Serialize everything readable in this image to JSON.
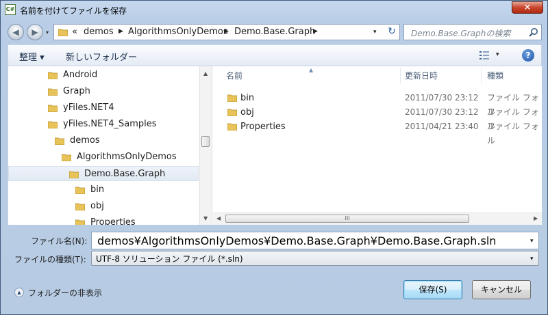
{
  "window": {
    "title": "名前を付けてファイルを保存",
    "app_icon_text": "C#",
    "close_glyph": "✕"
  },
  "nav": {
    "back_glyph": "◀",
    "forward_glyph": "▶",
    "breadcrumb": [
      "«",
      "demos",
      "AlgorithmsOnlyDemos",
      "Demo.Base.Graph"
    ],
    "separator_glyph": "▶",
    "dropdown_glyph": "▾",
    "refresh_glyph": "↻"
  },
  "search": {
    "placeholder": "Demo.Base.Graphの検索"
  },
  "toolbar": {
    "organize_label": "整理 ▾",
    "new_folder_label": "新しいフォルダー",
    "views_dropdown_glyph": "▾",
    "help_label": "?"
  },
  "tree": {
    "items": [
      {
        "label": "Android"
      },
      {
        "label": "Graph"
      },
      {
        "label": "yFiles.NET4"
      },
      {
        "label": "yFiles.NET4_Samples"
      },
      {
        "label": "demos"
      },
      {
        "label": "AlgorithmsOnlyDemos"
      },
      {
        "label": "Demo.Base.Graph",
        "selected": true
      },
      {
        "label": "bin"
      },
      {
        "label": "obj"
      },
      {
        "label": "Properties"
      }
    ],
    "scroll_up": "▲",
    "scroll_down": "▼"
  },
  "files": {
    "columns": {
      "name": "名前",
      "date": "更新日時",
      "type": "種類",
      "sort_glyph": "▲"
    },
    "rows": [
      {
        "name": "bin",
        "date": "2011/07/30 23:12",
        "type": "ファイル フォル"
      },
      {
        "name": "obj",
        "date": "2011/07/30 23:12",
        "type": "ファイル フォル"
      },
      {
        "name": "Properties",
        "date": "2011/04/21 23:40",
        "type": "ファイル フォル"
      }
    ],
    "hscroll_left": "◀",
    "hscroll_right": "▶",
    "hscroll_grip": "III"
  },
  "form": {
    "filename_label": "ファイル名(N):",
    "filename_value": "demos¥AlgorithmsOnlyDemos¥Demo.Base.Graph¥Demo.Base.Graph.sln",
    "filetype_label": "ファイルの種類(T):",
    "filetype_value": "UTF-8 ソリューション ファイル (*.sln)",
    "dropdown_glyph": "▾"
  },
  "footer": {
    "hide_folders_label": "フォルダーの非表示",
    "hide_folders_glyph": "▲",
    "save_label": "保存(S)",
    "cancel_label": "キャンセル"
  }
}
